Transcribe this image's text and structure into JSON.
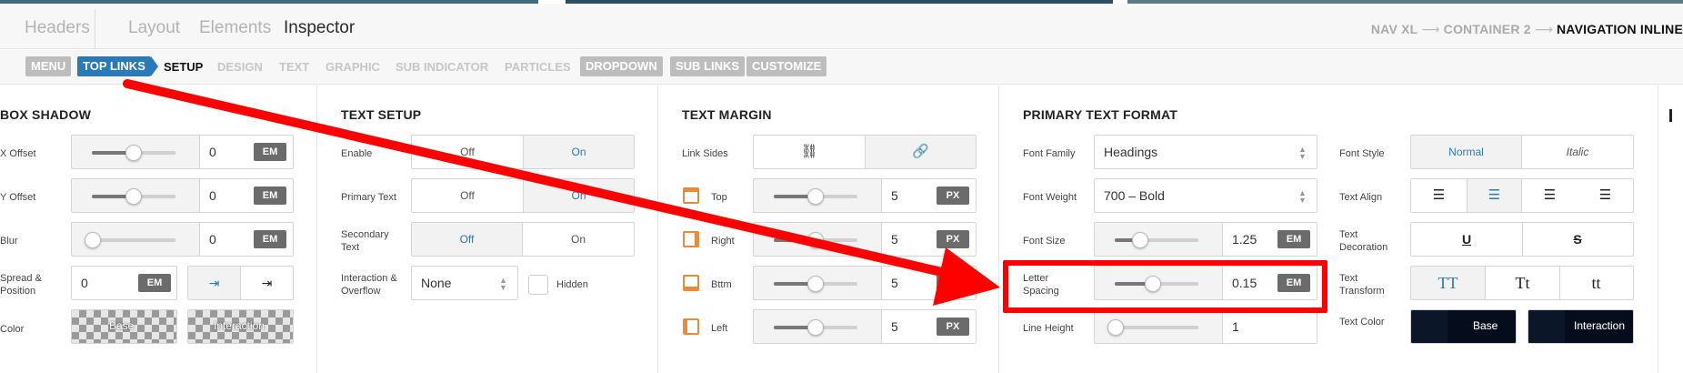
{
  "header": {
    "tabs": [
      {
        "label": "Headers",
        "active": false
      },
      {
        "label": "Layout",
        "active": false
      },
      {
        "label": "Elements",
        "active": false
      },
      {
        "label": "Inspector",
        "active": true
      }
    ],
    "breadcrumb": [
      "NAV XL",
      "CONTAINER 2",
      "NAVIGATION INLINE"
    ]
  },
  "subnav": {
    "items": [
      {
        "label": "MENU",
        "style": "pill"
      },
      {
        "label": "TOP LINKS",
        "style": "pill-active"
      },
      {
        "label": "SETUP",
        "style": "current"
      },
      {
        "label": "DESIGN",
        "style": "plain"
      },
      {
        "label": "TEXT",
        "style": "plain"
      },
      {
        "label": "GRAPHIC",
        "style": "plain"
      },
      {
        "label": "SUB INDICATOR",
        "style": "plain"
      },
      {
        "label": "PARTICLES",
        "style": "plain"
      },
      {
        "label": "DROPDOWN",
        "style": "pill"
      },
      {
        "label": "SUB LINKS",
        "style": "pill"
      },
      {
        "label": "CUSTOMIZE",
        "style": "pill"
      }
    ]
  },
  "box_shadow": {
    "title": "BOX SHADOW",
    "x_offset": {
      "label": "X Offset",
      "value": "0",
      "unit": "EM"
    },
    "y_offset": {
      "label": "Y Offset",
      "value": "0",
      "unit": "EM"
    },
    "blur": {
      "label": "Blur",
      "value": "0",
      "unit": "EM"
    },
    "spread": {
      "label": "Spread & Position",
      "value": "0",
      "unit": "EM"
    },
    "color": {
      "label": "Color",
      "base": "Base",
      "interaction": "Interaction"
    }
  },
  "text_setup": {
    "title": "TEXT SETUP",
    "enable": {
      "label": "Enable",
      "off": "Off",
      "on": "On",
      "selected": "On"
    },
    "primary_text": {
      "label": "Primary Text",
      "off": "Off",
      "on": "On",
      "selected": "On"
    },
    "secondary_text": {
      "label": "Secondary Text",
      "off": "Off",
      "on": "On",
      "selected": "Off"
    },
    "interaction": {
      "label": "Interaction & Overflow",
      "value": "None",
      "hidden_label": "Hidden"
    }
  },
  "text_margin": {
    "title": "TEXT MARGIN",
    "link_sides": {
      "label": "Link Sides"
    },
    "rows": [
      {
        "label": "Top",
        "value": "5",
        "unit": "PX"
      },
      {
        "label": "Right",
        "value": "5",
        "unit": "PX"
      },
      {
        "label": "Bttm",
        "value": "5",
        "unit": "PX"
      },
      {
        "label": "Left",
        "value": "5",
        "unit": "PX"
      }
    ]
  },
  "primary_text_format": {
    "title": "PRIMARY TEXT FORMAT",
    "font_family": {
      "label": "Font Family",
      "value": "Headings"
    },
    "font_weight": {
      "label": "Font Weight",
      "value": "700 – Bold"
    },
    "font_size": {
      "label": "Font Size",
      "value": "1.25",
      "unit": "EM"
    },
    "letter_spacing": {
      "label": "Letter Spacing",
      "value": "0.15",
      "unit": "EM"
    },
    "line_height": {
      "label": "Line Height",
      "value": "1"
    },
    "font_style": {
      "label": "Font Style",
      "normal": "Normal",
      "italic": "Italic",
      "selected": "Normal"
    },
    "text_align": {
      "label": "Text Align"
    },
    "text_decoration": {
      "label": "Text Decoration"
    },
    "text_transform": {
      "label": "Text Transform",
      "options": [
        "TT",
        "Tt",
        "tt"
      ]
    },
    "text_color": {
      "label": "Text Color",
      "base": "Base",
      "interaction": "Interaction"
    }
  },
  "colors": {
    "accent": "#2a7ab8",
    "annotation": "#ff0000",
    "side_icon": "#e98b3b"
  }
}
